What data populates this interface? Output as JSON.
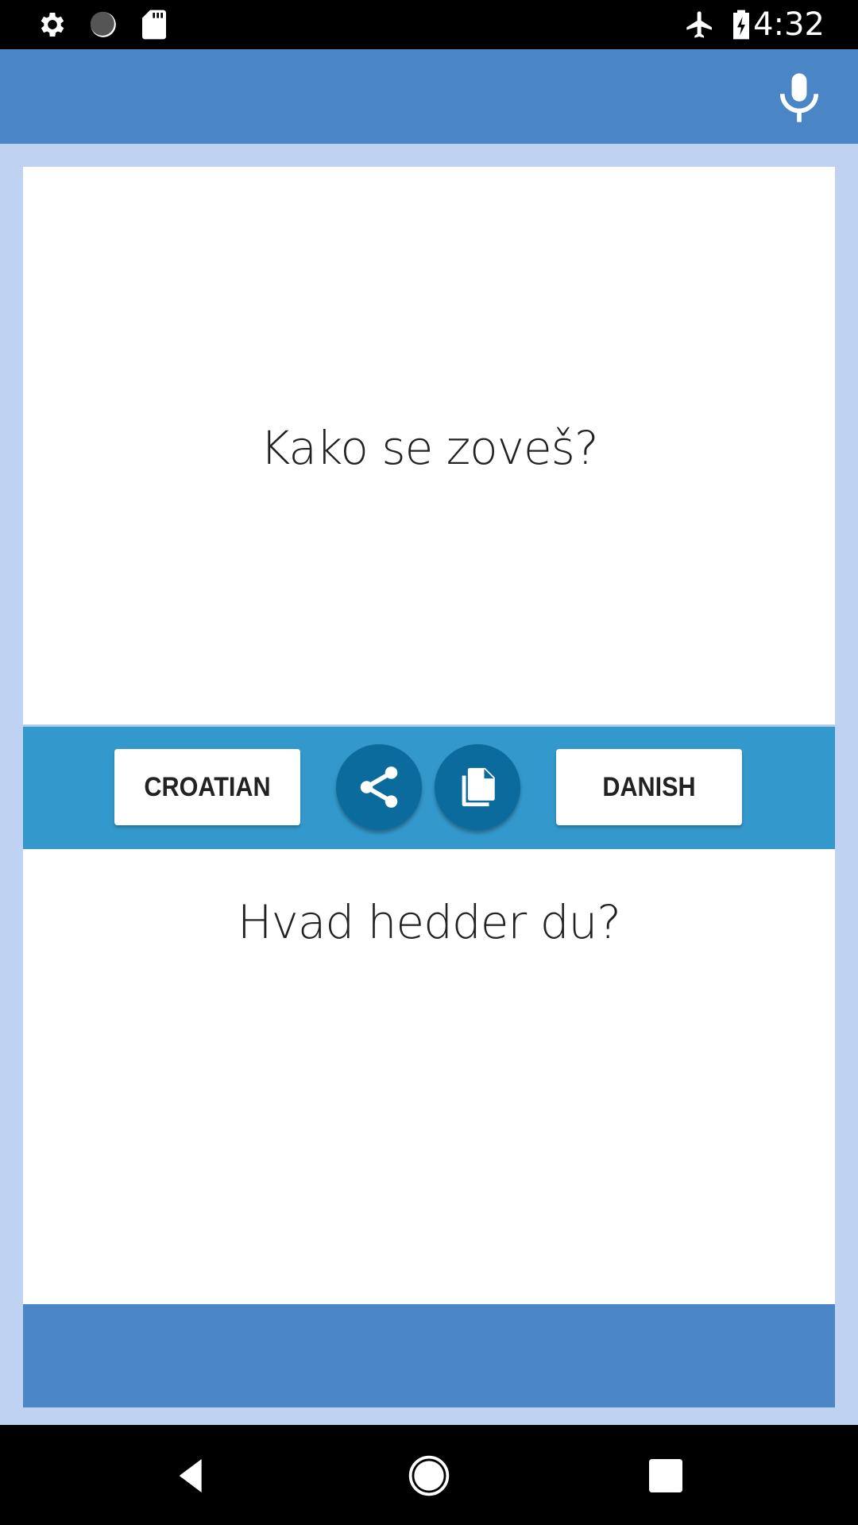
{
  "status_bar": {
    "time": "4:32",
    "left_icons": [
      "gear-icon",
      "sync-progress-icon",
      "sd-card-icon"
    ],
    "right_icons": [
      "airplane-mode-icon",
      "battery-charging-icon"
    ]
  },
  "app_bar": {
    "action_icon": "microphone-icon"
  },
  "translator": {
    "source_text": "Kako se zoveš?",
    "target_text": "Hvad hedder du?",
    "source_language": "CROATIAN",
    "target_language": "DANISH",
    "share_icon": "share-icon",
    "copy_icon": "copy-icon"
  },
  "colors": {
    "app_bar": "#4a86c5",
    "background": "#c0d2f2",
    "toolbar": "#3399cc",
    "round_button": "#0a6b9c"
  },
  "nav_bar": {
    "buttons": [
      "back",
      "home",
      "recents"
    ]
  }
}
